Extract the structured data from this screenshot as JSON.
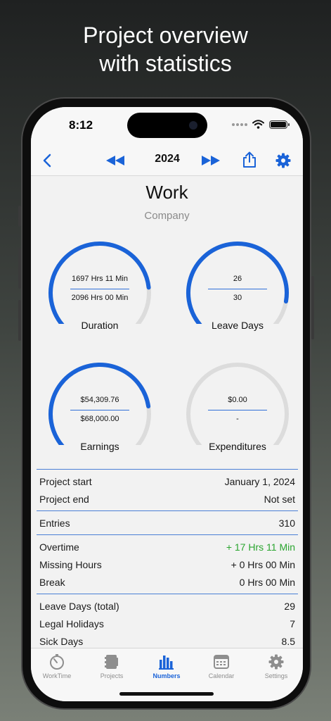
{
  "headline": {
    "line1": "Project overview",
    "line2": "with statistics"
  },
  "status": {
    "time": "8:12"
  },
  "nav": {
    "year": "2024"
  },
  "project": {
    "title": "Work",
    "subtitle": "Company"
  },
  "gauges": [
    {
      "label": "Duration",
      "top": "1697 Hrs 11 Min",
      "bottom": "2096 Hrs 00 Min",
      "fraction": 0.81
    },
    {
      "label": "Leave Days",
      "top": "26",
      "bottom": "30",
      "fraction": 0.87
    },
    {
      "label": "Earnings",
      "top": "$54,309.76",
      "bottom": "$68,000.00",
      "fraction": 0.8
    },
    {
      "label": "Expenditures",
      "top": "$0.00",
      "bottom": "-",
      "fraction": 0
    }
  ],
  "stats": {
    "project_start": {
      "label": "Project start",
      "value": "January 1, 2024"
    },
    "project_end": {
      "label": "Project end",
      "value": "Not set"
    },
    "entries": {
      "label": "Entries",
      "value": "310"
    },
    "overtime": {
      "label": "Overtime",
      "value": "+ 17 Hrs 11 Min"
    },
    "missing_hours": {
      "label": "Missing Hours",
      "value": "+ 0 Hrs 00 Min"
    },
    "break": {
      "label": "Break",
      "value": "0 Hrs 00 Min"
    },
    "leave_days_total": {
      "label": "Leave Days (total)",
      "value": "29"
    },
    "legal_holidays": {
      "label": "Legal Holidays",
      "value": "7"
    },
    "sick_days": {
      "label": "Sick Days",
      "value": "8.5"
    }
  },
  "tabs": [
    {
      "label": "WorkTime",
      "icon": "timer-icon"
    },
    {
      "label": "Projects",
      "icon": "folder-icon"
    },
    {
      "label": "Numbers",
      "icon": "bar-chart-icon"
    },
    {
      "label": "Calendar",
      "icon": "calendar-icon"
    },
    {
      "label": "Settings",
      "icon": "gear-icon"
    }
  ],
  "colors": {
    "accent": "#1a63d8",
    "track": "#dcdcdc",
    "positive": "#2aa52f"
  }
}
